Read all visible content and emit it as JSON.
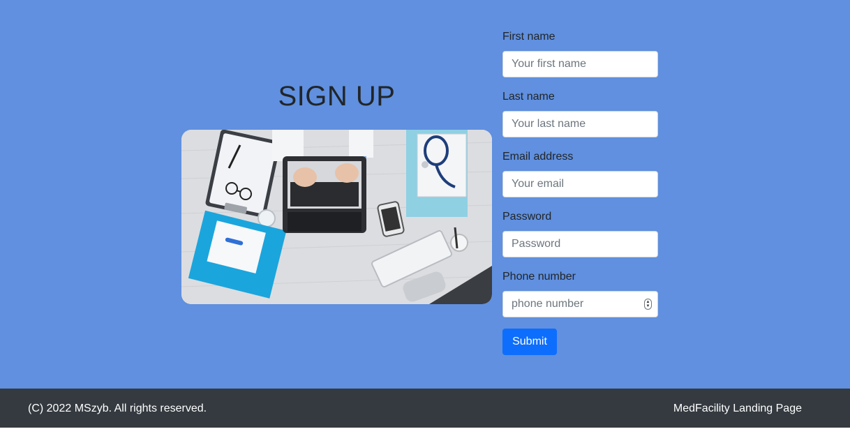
{
  "signup": {
    "heading": "SIGN UP"
  },
  "form": {
    "first_name": {
      "label": "First name",
      "placeholder": "Your first name"
    },
    "last_name": {
      "label": "Last name",
      "placeholder": "Your last name"
    },
    "email": {
      "label": "Email address",
      "placeholder": "Your email"
    },
    "password": {
      "label": "Password",
      "placeholder": "Password"
    },
    "phone": {
      "label": "Phone number",
      "placeholder": "phone number"
    },
    "submit_label": "Submit"
  },
  "footer": {
    "copyright": "(C) 2022 MSzyb. All rights reserved.",
    "brand": "MedFacility Landing Page"
  },
  "colors": {
    "page_background": "#6090df",
    "footer_background": "#343a40",
    "primary_button": "#0d6efd"
  },
  "icons": {
    "spinner": "number-spinner-icon"
  }
}
